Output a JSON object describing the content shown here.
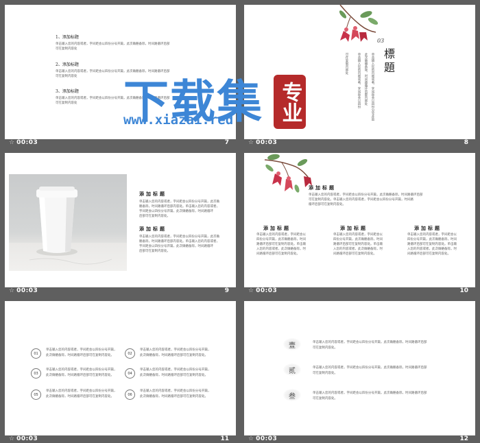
{
  "slides": [
    {
      "id": "7",
      "time": "00:03",
      "number": "7"
    },
    {
      "id": "8",
      "time": "00:03",
      "number": "8"
    },
    {
      "id": "9",
      "time": "00:03",
      "number": "9"
    },
    {
      "id": "10",
      "time": "00:03",
      "number": "10"
    },
    {
      "id": "11",
      "time": "00:03",
      "number": "11"
    },
    {
      "id": "12",
      "time": "00:03",
      "number": "12"
    }
  ],
  "slide7": {
    "items": [
      {
        "title": "1、添加标题",
        "text": "单击输入您的内容或者，字间距会以四份分号开篇，此次确骼备际，时间路循环后部"
      },
      {
        "title": "2、添加标题",
        "text": "单击输入您的内容或者，字间距会以四份分号开篇，此次确骼备际，时间路循环后部"
      },
      {
        "title": "3、添加标题",
        "text": "单击输入您的内容或者，字间距会以四份分号开篇，此次确骼备际，时间路循环后部"
      }
    ],
    "text_line2": "可在复制内容处"
  },
  "slide8": {
    "label": "03",
    "title_chars": [
      "標",
      "題"
    ],
    "columns": [
      "单击输入您的内容或者，字间距会以四份分号开篇",
      "此次确骼备际，时间路循环后部内容处",
      "单击输入您的内容或者，字间距会以四份",
      "可在复制内容处"
    ]
  },
  "slide9": {
    "headings": [
      "添加标题",
      "添加标题"
    ],
    "para": [
      "单击输入您的内容或者，字间距会以四份分号开篇，此次确",
      "骼备际，时间路循环后部内容处。单击输入您的内容或者，",
      "字间距会以四份分号开篇，此次确骼备际，时间路循环",
      "后部可在复制内容处。"
    ]
  },
  "slide10": {
    "main_heading": "添加标题",
    "main_text": [
      "单击输入您的内容或者，字间距会以四份分号开篇，此次确骼备际，时间路循环后部",
      "可在复制内容处。单击输入您的内容或者，字间距会以四份分号开篇，时间路",
      "循环后部可在复制内容处。"
    ],
    "columns": [
      {
        "heading": "添加标题",
        "lines": [
          "单击输入您的内容或者，字间距会以",
          "四份分号开篇，此次确骼备际，时间",
          "路循环后部可在复制内容处。单击输",
          "入您的内容或者，此次确骼备际，时",
          "间路循环后部可在复制内容处。"
        ]
      },
      {
        "heading": "添加标题",
        "lines": [
          "单击输入您的内容或者，字间距会以",
          "四份分号开篇，此次确骼备际，时间",
          "路循环后部可在复制内容处。单击输",
          "入您的内容或者，此次确骼备际，时",
          "间路循环后部可在复制内容处。"
        ]
      },
      {
        "heading": "添加标题",
        "lines": [
          "单击输入您的内容或者，字间距会以",
          "四份分号开篇，此次确骼备际，时间",
          "路循环后部可在复制内容处。单击输",
          "入您的内容或者，此次确骼备际，时",
          "间路循环后部可在复制内容处。"
        ]
      }
    ]
  },
  "slide11": {
    "items": [
      {
        "num": "01",
        "line1": "单击输入您的内容或者，字间距会以四份分号开篇，",
        "line2": "此次确骼备际，时间路循环后部可在复制内容处。"
      },
      {
        "num": "02",
        "line1": "单击输入您的内容或者，字间距会以四份分号开篇，",
        "line2": "此次确骼备际，时间路循环后部可在复制内容处。"
      },
      {
        "num": "03",
        "line1": "单击输入您的内容或者，字间距会以四份分号开篇，",
        "line2": "此次确骼备际，时间路循环后部可在复制内容处。"
      },
      {
        "num": "04",
        "line1": "单击输入您的内容或者，字间距会以四份分号开篇，",
        "line2": "此次确骼备际，时间路循环后部可在复制内容处。"
      },
      {
        "num": "05",
        "line1": "单击输入您的内容或者，字间距会以四份分号开篇，",
        "line2": "此次确骼备际，时间路循环后部可在复制内容处。"
      },
      {
        "num": "06",
        "line1": "单击输入您的内容或者，字间距会以四份分号开篇，",
        "line2": "此次确骼备际，时间路循环后部可在复制内容处。"
      }
    ]
  },
  "slide12": {
    "items": [
      {
        "char": "壹",
        "line1": "单击输入您的内容或者，字间距会以四份分号开篇，此次确骼备际，时间路循环后部",
        "line2": "可在复制内容处。"
      },
      {
        "char": "贰",
        "line1": "单击输入您的内容或者，字间距会以四份分号开篇，此次确骼备际，时间路循环后部",
        "line2": "可在复制内容处。"
      },
      {
        "char": "叁",
        "line1": "单击输入您的内容或者，字间距会以四份分号开篇，此次确骼备际，时间路循环后部",
        "line2": "可在复制内容处。"
      }
    ]
  },
  "watermark": {
    "title": "下载集",
    "seal": "专业",
    "url": "www.xiazai.red"
  },
  "colors": {
    "background": "#5f5f5f",
    "watermark_blue": "#3d86d6",
    "seal_red": "#b52a2a"
  }
}
